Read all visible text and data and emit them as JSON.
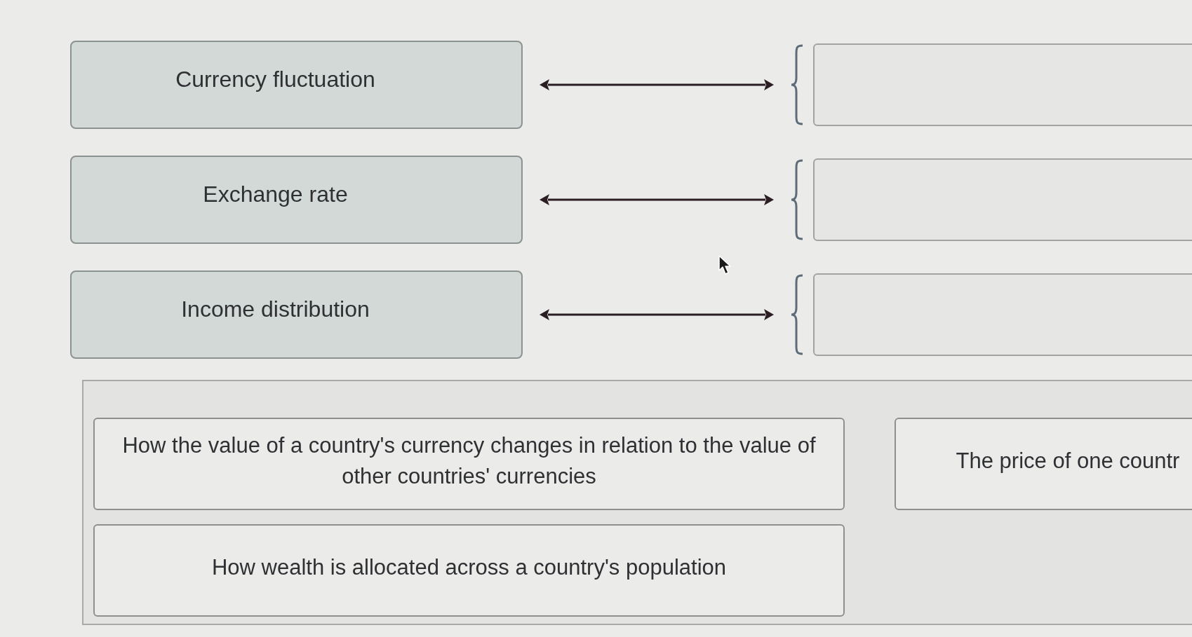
{
  "matching_rows": [
    {
      "term": "Currency fluctuation"
    },
    {
      "term": "Exchange rate"
    },
    {
      "term": "Income distribution"
    }
  ],
  "choices_panel": {
    "choices": [
      {
        "text": "How the value of a country's currency changes in relation to the value of other countries' currencies"
      },
      {
        "text": "The price of one countr"
      },
      {
        "text": "How wealth is allocated across a country's population"
      }
    ]
  }
}
